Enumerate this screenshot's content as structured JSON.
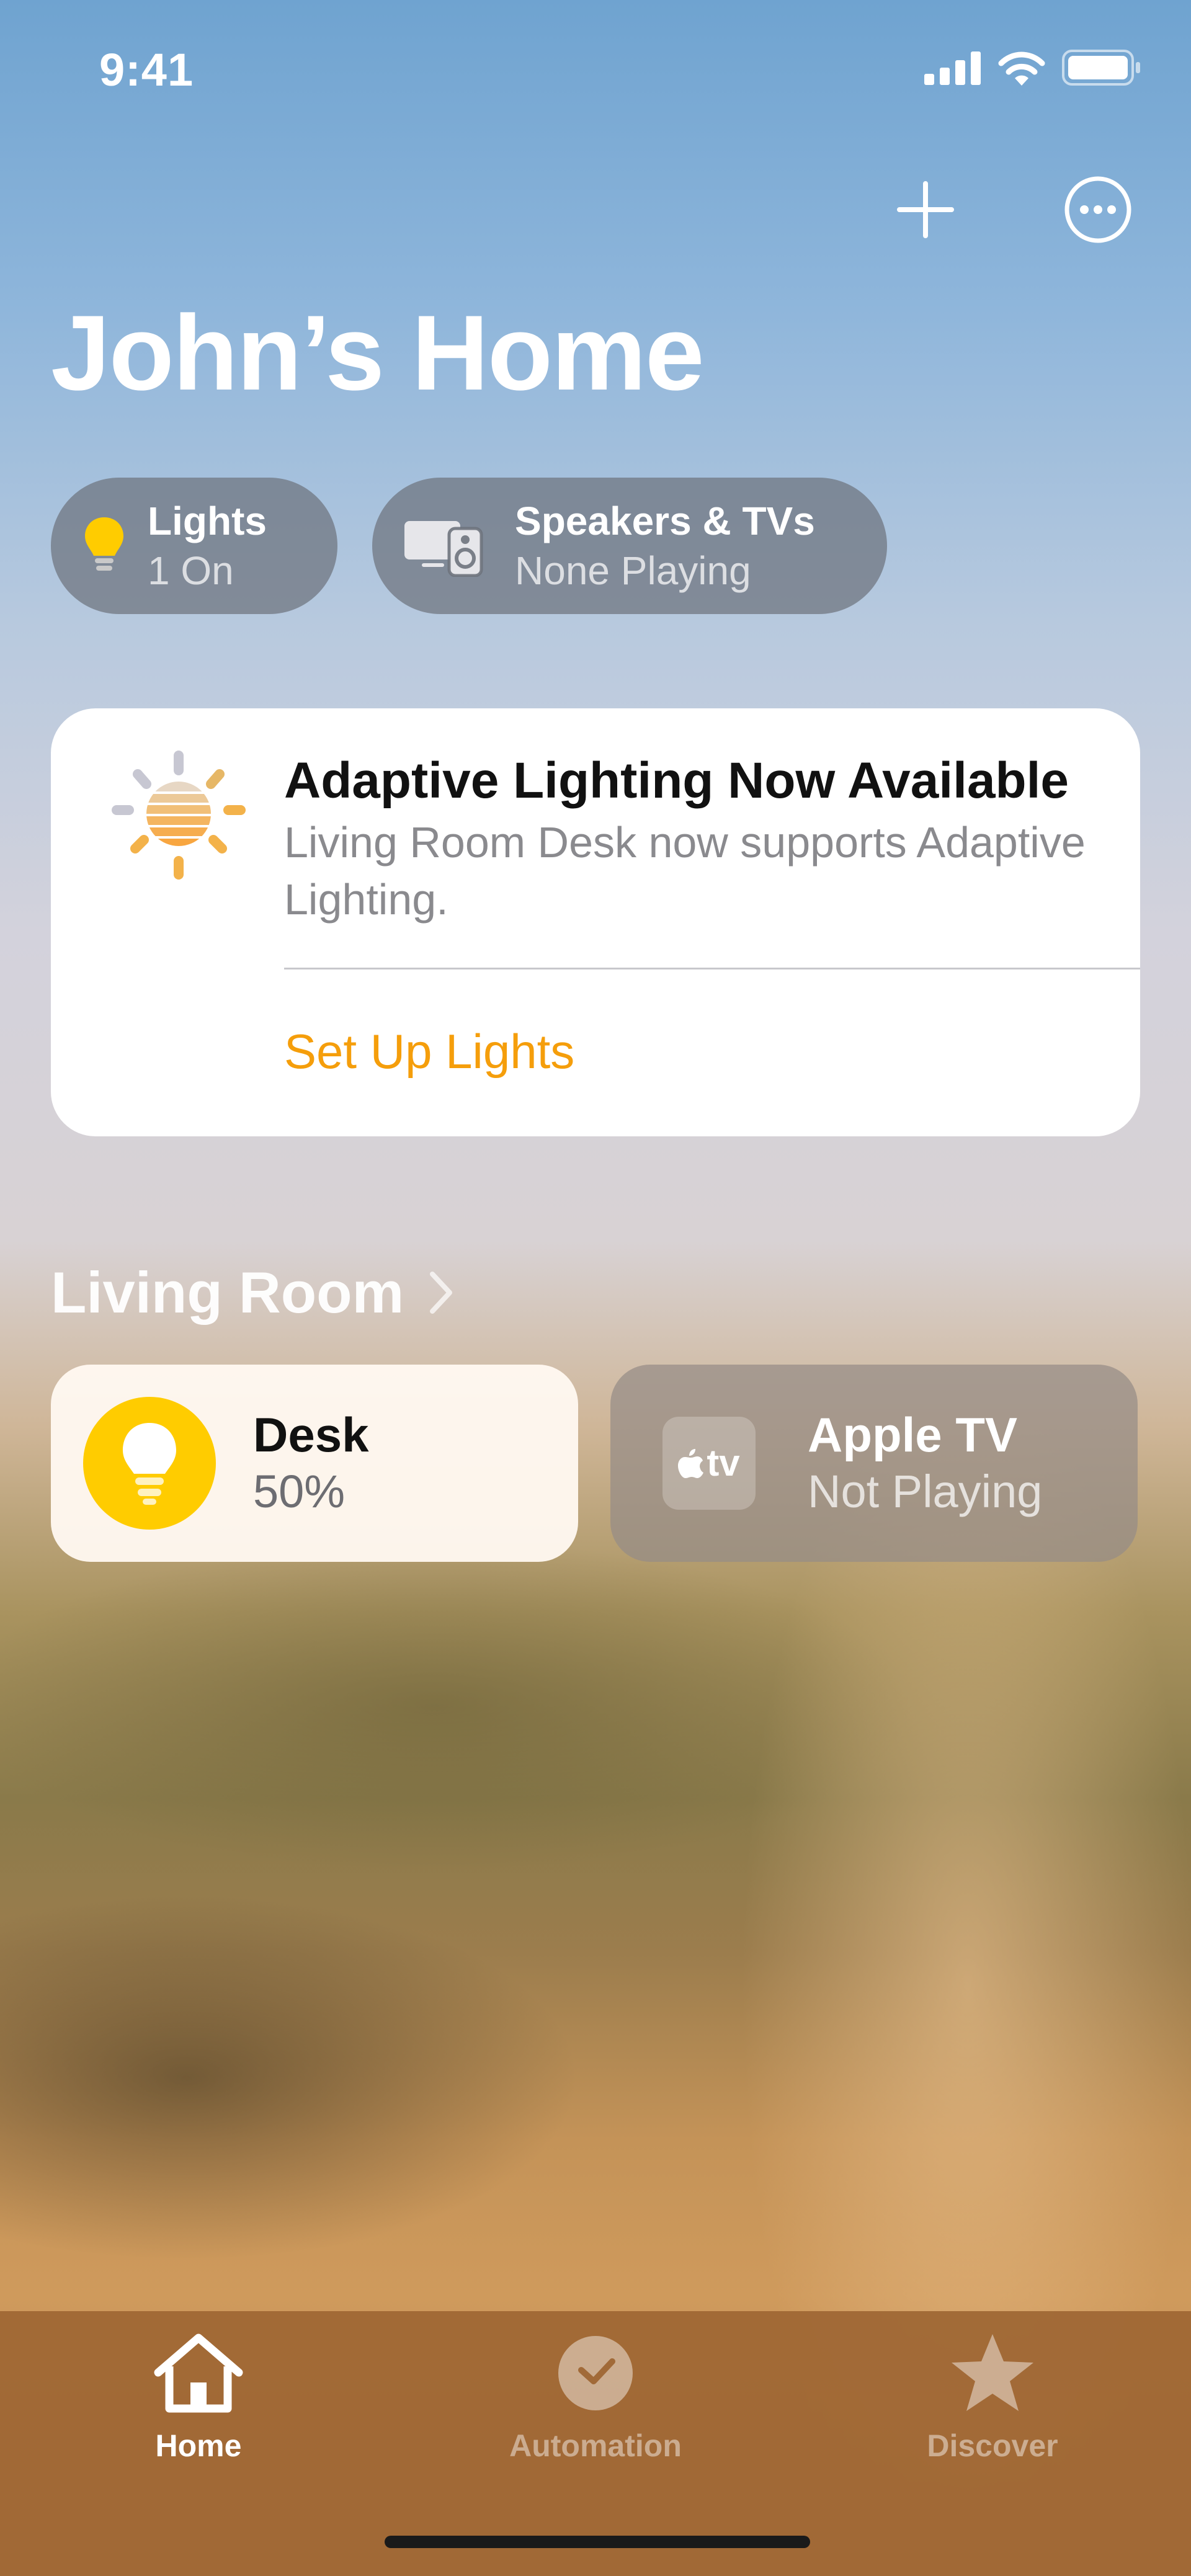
{
  "status_bar": {
    "time": "9:41"
  },
  "header": {
    "title": "John’s Home",
    "add_icon": "plus-icon",
    "more_icon": "ellipsis-circle-icon"
  },
  "chips": [
    {
      "title": "Lights",
      "subtitle": "1 On",
      "icon": "lightbulb-icon"
    },
    {
      "title": "Speakers & TVs",
      "subtitle": "None Playing",
      "icon": "speaker-tv-icon"
    }
  ],
  "card": {
    "title": "Adaptive Lighting Now Available",
    "body": "Living Room Desk now supports Adaptive Lighting.",
    "action": "Set Up Lights",
    "icon": "adaptive-lighting-sun-icon"
  },
  "section": {
    "title": "Living Room"
  },
  "accessories": [
    {
      "name": "Desk",
      "status": "50%",
      "icon": "lightbulb-icon",
      "state": "on"
    },
    {
      "name": "Apple TV",
      "status": "Not Playing",
      "icon": "apple-tv-icon",
      "icon_text": "tv",
      "state": "off"
    }
  ],
  "tabbar": {
    "tabs": [
      {
        "label": "Home",
        "icon": "house-icon",
        "selected": true
      },
      {
        "label": "Automation",
        "icon": "clock-check-icon",
        "selected": false
      },
      {
        "label": "Discover",
        "icon": "star-icon",
        "selected": false
      }
    ]
  },
  "colors": {
    "accent": "#f59e0b",
    "bulb_on": "#ffcc00",
    "tabbar": "#9e6634"
  }
}
